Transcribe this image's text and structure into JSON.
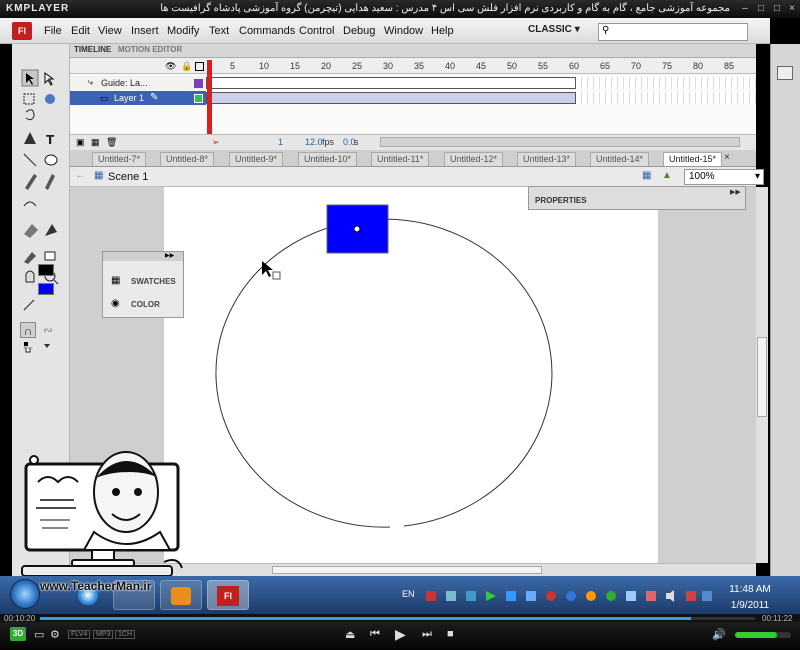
{
  "player": {
    "logo": "KMPLAYER",
    "caption": "مجموعه آموزشی جامع ، گام به گام و کاربردی نرم افزار فلش سی اس ۴ مدرس : سعید هدایی (تیچرمن) گروه آموزشی پادشاه گرافیست ها",
    "time_elapsed": "00:10:20",
    "time_total": "00:11:22",
    "progress": 0.91,
    "badges": [
      "FLV4",
      "MP3",
      "1CH"
    ],
    "volume": 0.75
  },
  "menu": {
    "logo": "Fl",
    "items": [
      "File",
      "Edit",
      "View",
      "Insert",
      "Modify",
      "Text",
      "Commands",
      "Control",
      "Debug",
      "Window",
      "Help"
    ],
    "workspace": "CLASSIC"
  },
  "timeline": {
    "tabs": [
      "TIMELINE",
      "MOTION EDITOR"
    ],
    "frame_numbers": [
      "5",
      "10",
      "15",
      "20",
      "25",
      "30",
      "35",
      "40",
      "45",
      "50",
      "55",
      "60",
      "65",
      "70",
      "75",
      "80",
      "85"
    ],
    "layers": [
      "Guide: La...",
      "Layer 1"
    ],
    "current_frame": "1",
    "fps": "12.0",
    "fps_unit": "fps",
    "time": "0.0",
    "time_unit": "s"
  },
  "doc_tabs": [
    "Untitled-7*",
    "Untitled-8*",
    "Untitled-9*",
    "Untitled-10*",
    "Untitled-11*",
    "Untitled-12*",
    "Untitled-13*",
    "Untitled-14*",
    "Untitled-15*"
  ],
  "active_doc_tab": "Untitled-15*",
  "scene": {
    "name": "Scene 1",
    "zoom": "100%"
  },
  "panels": {
    "properties": "PROPERTIES",
    "swatches": "SWATCHES",
    "color": "COLOR"
  },
  "colors": {
    "fill": "#0000ff",
    "stroke": "#000000",
    "accent": "#c21f1f"
  },
  "taskbar": {
    "lang": "EN",
    "time": "11:48 AM",
    "date": "1/9/2011"
  },
  "watermark": {
    "url": "www.TeacherMan.ir"
  }
}
